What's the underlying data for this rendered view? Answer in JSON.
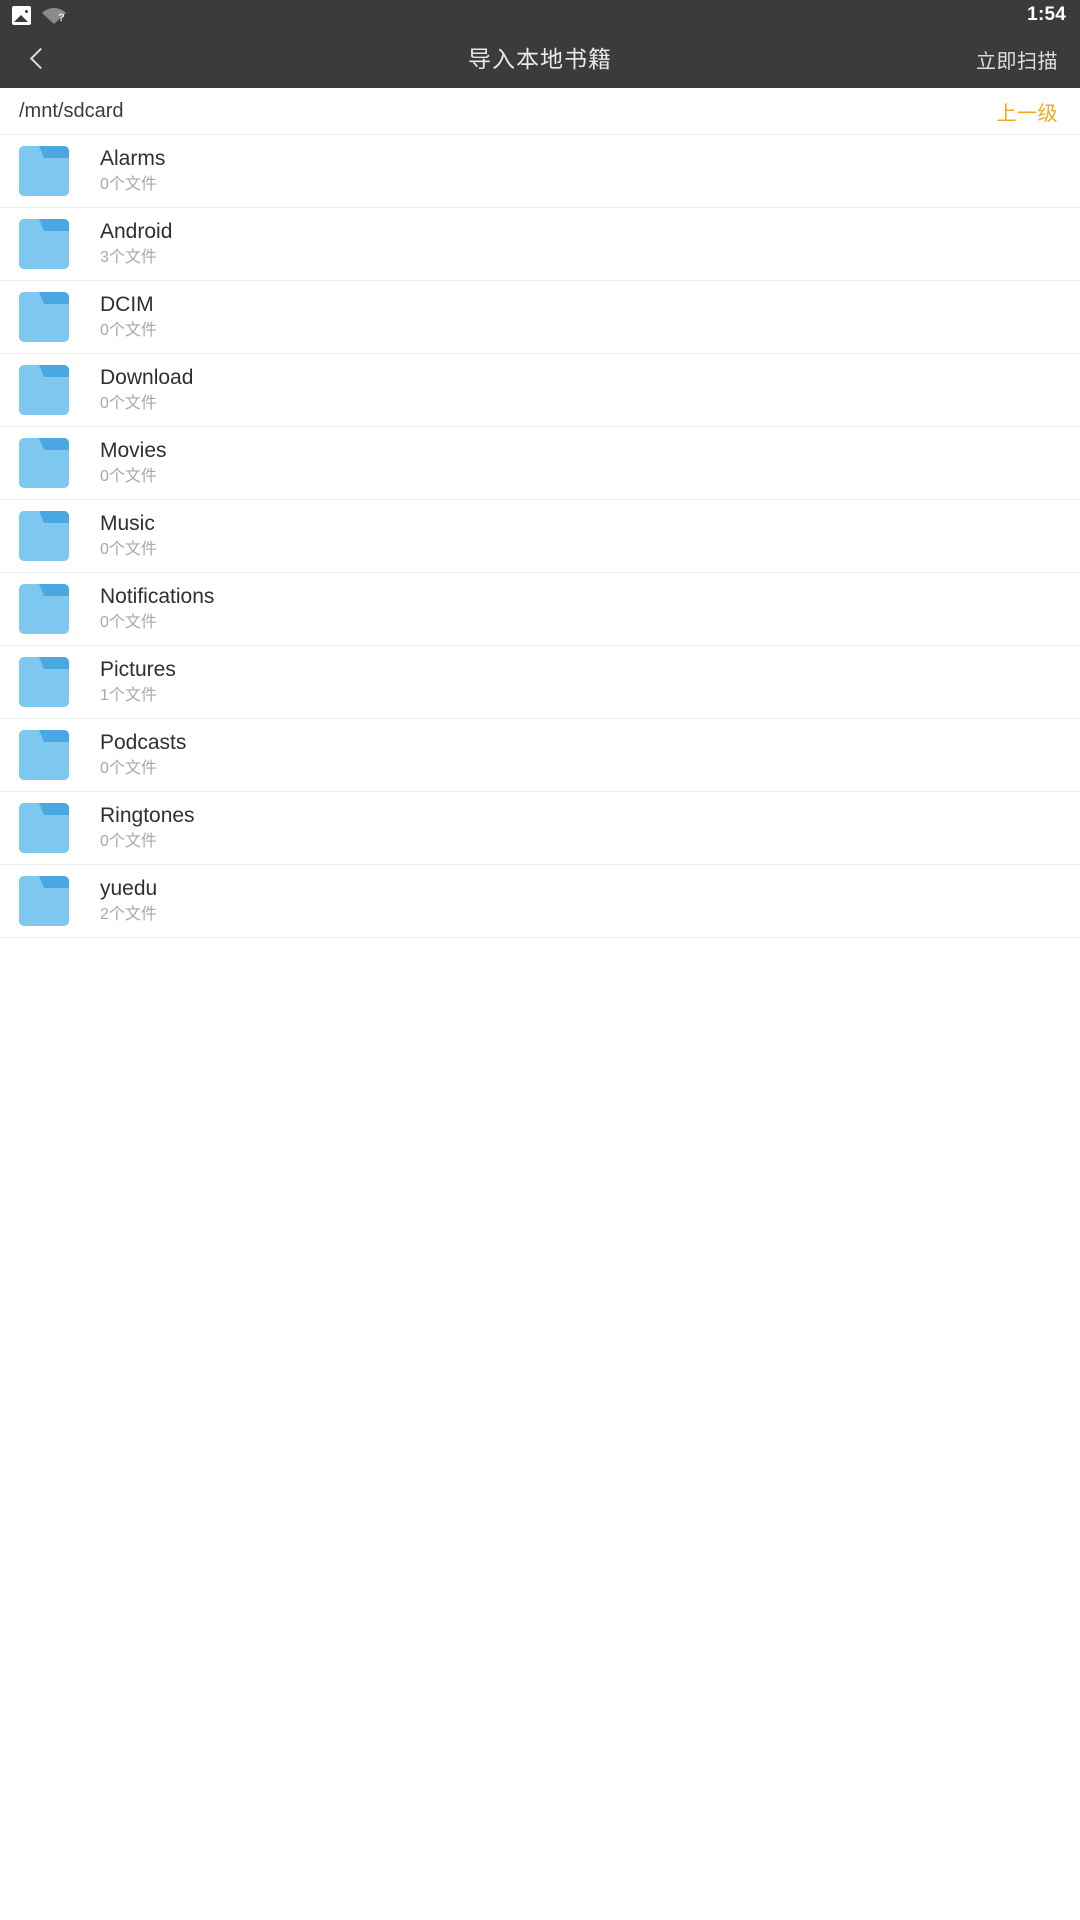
{
  "status_bar": {
    "icons": [
      "image-icon",
      "wifi-unknown-icon"
    ],
    "time": "1:54",
    "background_color": "#3b3b3b"
  },
  "toolbar": {
    "back_icon": "chevron-left-icon",
    "title": "导入本地书籍",
    "action_label": "立即扫描"
  },
  "path_bar": {
    "path": "/mnt/sdcard",
    "up_label": "上一级",
    "up_color": "#efa924"
  },
  "file_list": {
    "items": [
      {
        "name": "Alarms",
        "sub": "0个文件",
        "icon": "folder-icon"
      },
      {
        "name": "Android",
        "sub": "3个文件",
        "icon": "folder-icon"
      },
      {
        "name": "DCIM",
        "sub": "0个文件",
        "icon": "folder-icon"
      },
      {
        "name": "Download",
        "sub": "0个文件",
        "icon": "folder-icon"
      },
      {
        "name": "Movies",
        "sub": "0个文件",
        "icon": "folder-icon"
      },
      {
        "name": "Music",
        "sub": "0个文件",
        "icon": "folder-icon"
      },
      {
        "name": "Notifications",
        "sub": "0个文件",
        "icon": "folder-icon"
      },
      {
        "name": "Pictures",
        "sub": "1个文件",
        "icon": "folder-icon"
      },
      {
        "name": "Podcasts",
        "sub": "0个文件",
        "icon": "folder-icon"
      },
      {
        "name": "Ringtones",
        "sub": "0个文件",
        "icon": "folder-icon"
      },
      {
        "name": "yuedu",
        "sub": "2个文件",
        "icon": "folder-icon"
      }
    ],
    "folder_color": "#7ec8ef",
    "folder_tab_color": "#4ba7e2"
  }
}
